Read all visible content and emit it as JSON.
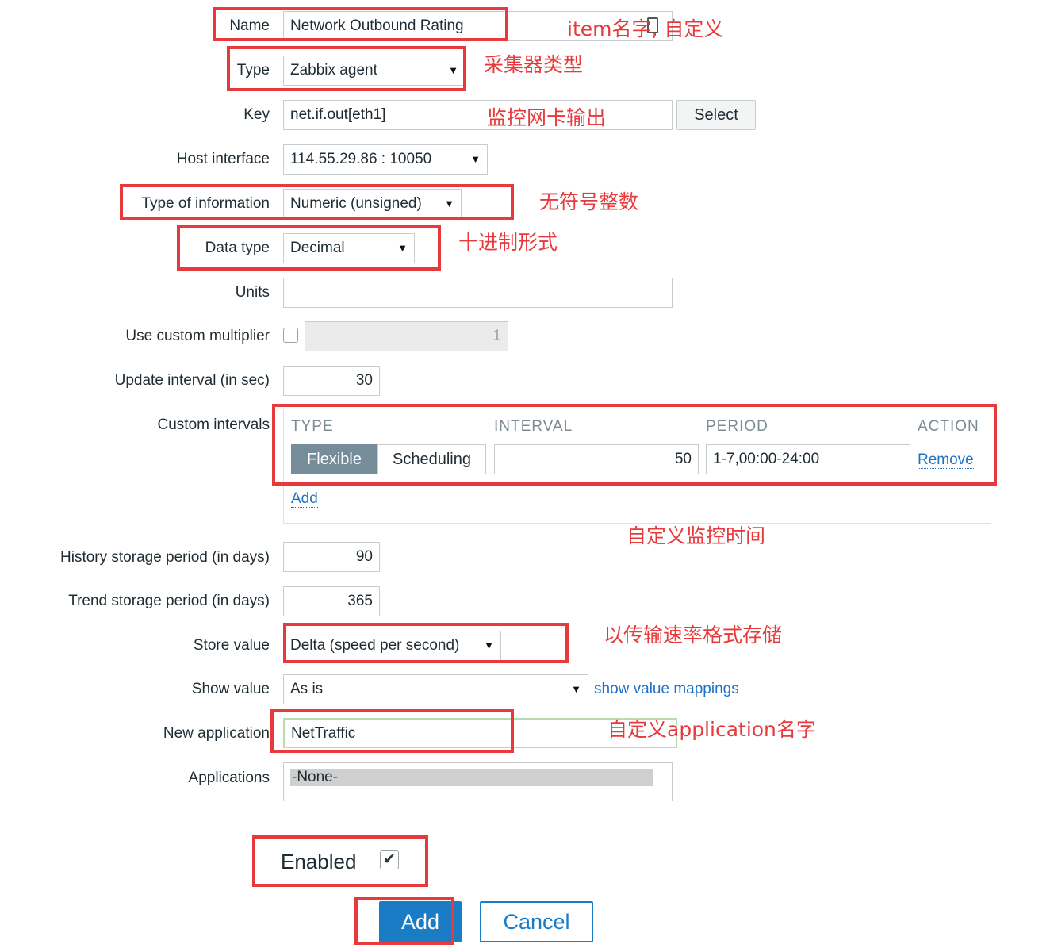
{
  "form": {
    "name": {
      "label": "Name",
      "value": "Network Outbound Rating"
    },
    "type": {
      "label": "Type",
      "value": "Zabbix agent"
    },
    "key": {
      "label": "Key",
      "value": "net.if.out[eth1]",
      "select_label": "Select"
    },
    "host_interface": {
      "label": "Host interface",
      "value": "114.55.29.86 : 10050"
    },
    "type_of_information": {
      "label": "Type of information",
      "value": "Numeric (unsigned)"
    },
    "data_type": {
      "label": "Data type",
      "value": "Decimal"
    },
    "units": {
      "label": "Units",
      "value": ""
    },
    "custom_multiplier": {
      "label": "Use custom multiplier",
      "checked": false,
      "value": "1"
    },
    "update_interval": {
      "label": "Update interval (in sec)",
      "value": "30"
    },
    "custom_intervals": {
      "label": "Custom intervals",
      "headers": {
        "type": "TYPE",
        "interval": "INTERVAL",
        "period": "PERIOD",
        "action": "ACTION"
      },
      "row": {
        "type_active": "Flexible",
        "type_other": "Scheduling",
        "interval": "50",
        "period": "1-7,00:00-24:00",
        "action": "Remove"
      },
      "add_label": "Add"
    },
    "history": {
      "label": "History storage period (in days)",
      "value": "90"
    },
    "trend": {
      "label": "Trend storage period (in days)",
      "value": "365"
    },
    "store_value": {
      "label": "Store value",
      "value": "Delta (speed per second)"
    },
    "show_value": {
      "label": "Show value",
      "value": "As is",
      "mappings_link": "show value mappings"
    },
    "new_application": {
      "label": "New application",
      "value": "NetTraffic"
    },
    "applications": {
      "label": "Applications",
      "options": [
        "-None-"
      ]
    },
    "enabled": {
      "label": "Enabled",
      "checked": true
    },
    "buttons": {
      "add": "Add",
      "cancel": "Cancel"
    }
  },
  "annotations": {
    "name_note": "item名字, 自定义",
    "type_note": "采集器类型",
    "key_note": "监控网卡输出",
    "info_note": "无符号整数",
    "datatype_note": "十进制形式",
    "intervals_note": "自定义监控时间",
    "store_note": "以传输速率格式存储",
    "app_note": "自定义application名字"
  },
  "colors": {
    "annotation": "#e8393c",
    "accent": "#1e72c4",
    "flexible_bg": "#768d99",
    "add_button_bg": "#1a7cc4"
  }
}
